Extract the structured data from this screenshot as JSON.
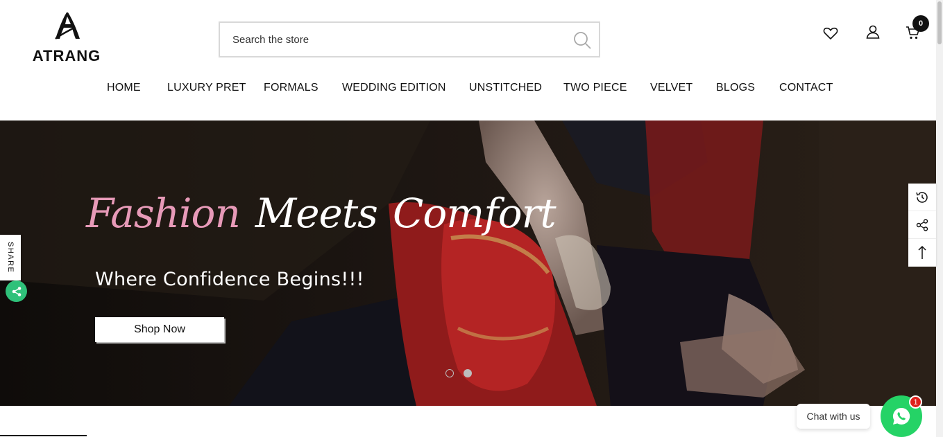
{
  "header": {
    "logo_text": "ATRANG",
    "search": {
      "placeholder": "Search the store"
    },
    "cart_count": "0"
  },
  "nav": {
    "items": [
      "HOME",
      "LUXURY PRET",
      "FORMALS",
      "WEDDING EDITION",
      "UNSTITCHED",
      "TWO PIECE",
      "VELVET",
      "BLOGS",
      "CONTACT"
    ]
  },
  "hero": {
    "title_word_1": "Fashion",
    "title_word_2": "Meets",
    "title_word_3": "Comfort",
    "subtitle": "Where Confidence Begins!!!",
    "cta_label": "Shop Now",
    "slide_count": 2,
    "active_slide": 2
  },
  "share_tab": {
    "label": "SHARE"
  },
  "tools": {
    "icons": [
      "history-icon",
      "share-icon",
      "arrow-up-icon"
    ]
  },
  "chat": {
    "label": "Chat with us",
    "badge": "1"
  },
  "colors": {
    "accent_pink": "#e79ab8",
    "whatsapp_green": "#25d366",
    "share_green": "#2fc17a",
    "badge_red": "#e0201c"
  }
}
